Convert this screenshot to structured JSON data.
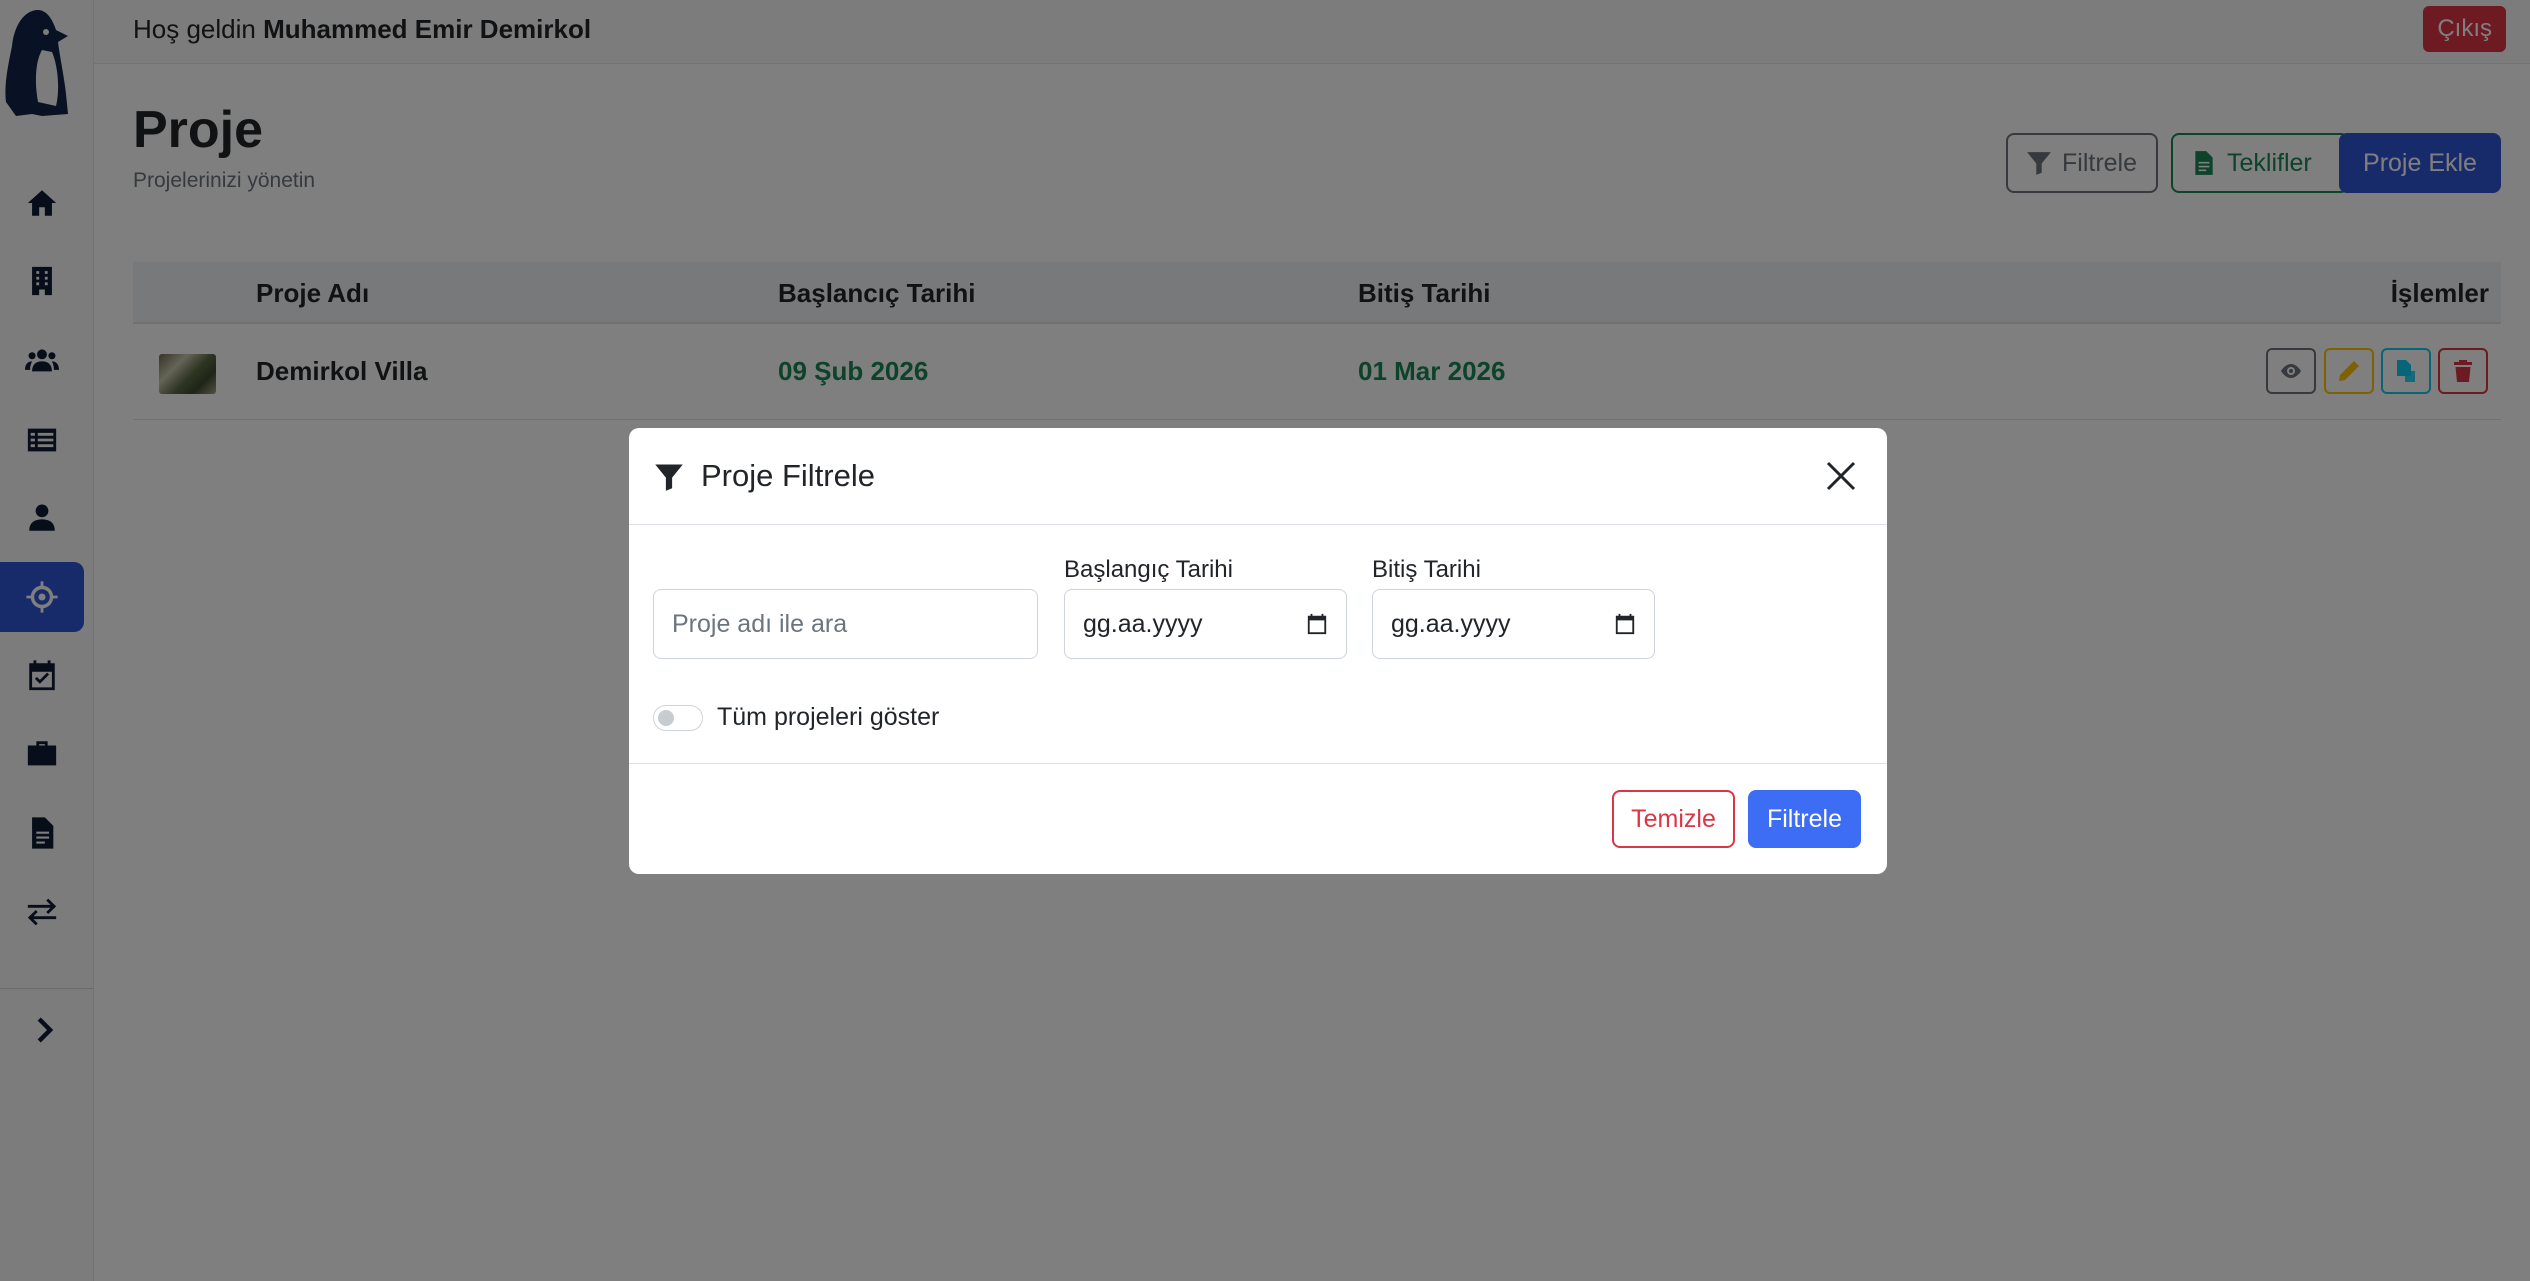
{
  "header": {
    "greeting_prefix": "Hoş geldin",
    "user_name": "Muhammed Emir Demirkol",
    "logout_label": "Çıkış"
  },
  "sidebar": {
    "items": [
      {
        "icon": "home-icon",
        "active": false
      },
      {
        "icon": "building-icon",
        "active": false
      },
      {
        "icon": "users-icon",
        "active": false
      },
      {
        "icon": "list-icon",
        "active": false
      },
      {
        "icon": "user-icon",
        "active": false
      },
      {
        "icon": "crosshair-icon",
        "active": true
      },
      {
        "icon": "calendar-check-icon",
        "active": false
      },
      {
        "icon": "briefcase-icon",
        "active": false
      },
      {
        "icon": "document-icon",
        "active": false
      },
      {
        "icon": "transfer-icon",
        "active": false
      }
    ],
    "expand_icon": "chevron-right-icon"
  },
  "page": {
    "title": "Proje",
    "subtitle": "Projelerinizi yönetin",
    "buttons": {
      "filter": "Filtrele",
      "offers": "Teklifler",
      "add": "Proje Ekle"
    }
  },
  "table": {
    "headers": {
      "name": "Proje Adı",
      "start": "Başlancıç Tarihi",
      "end": "Bitiş Tarihi",
      "actions": "İşlemler"
    },
    "rows": [
      {
        "name": "Demirkol Villa",
        "start": "09 Şub 2026",
        "end": "01 Mar 2026"
      }
    ]
  },
  "modal": {
    "title": "Proje Filtrele",
    "search_placeholder": "Proje adı ile ara",
    "start_label": "Başlangıç Tarihi",
    "end_label": "Bitiş Tarihi",
    "date_placeholder": "gg.aa.yyyy",
    "toggle_label": "Tüm projeleri göster",
    "toggle_on": false,
    "clear_label": "Temizle",
    "apply_label": "Filtrele"
  },
  "colors": {
    "primary": "#2f55d4",
    "success": "#198754",
    "danger": "#dc3545",
    "warning": "#ffc107",
    "info": "#0dcaf0"
  }
}
